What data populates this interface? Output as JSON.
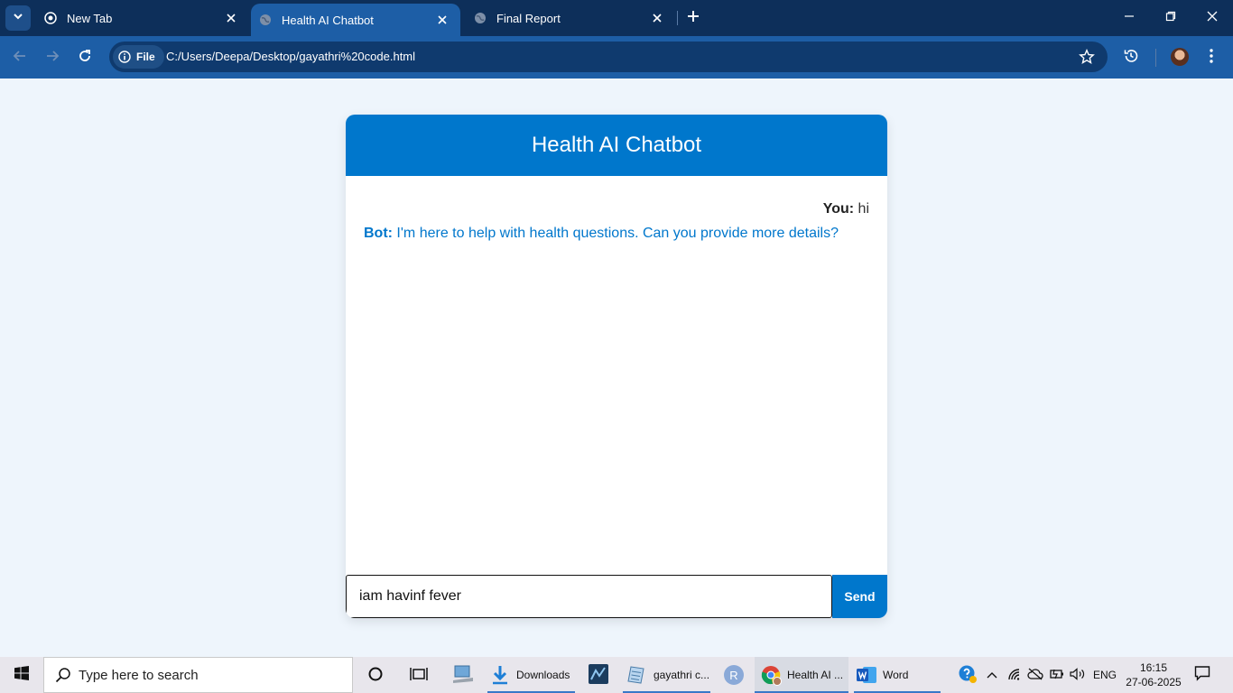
{
  "browser": {
    "tabs": [
      {
        "title": "New Tab",
        "active": false
      },
      {
        "title": "Health AI Chatbot",
        "active": true
      },
      {
        "title": "Final Report",
        "active": false
      }
    ],
    "site_chip": "File",
    "url": "C:/Users/Deepa/Desktop/gayathri%20code.html"
  },
  "page": {
    "header_title": "Health AI Chatbot",
    "messages": [
      {
        "sender": "You:",
        "text": " hi"
      },
      {
        "sender": "Bot:",
        "text": " I'm here to help with health questions. Can you provide more details?"
      }
    ],
    "input_value": "iam havinf fever",
    "send_label": "Send"
  },
  "taskbar": {
    "search_placeholder": "Type here to search",
    "apps": [
      {
        "label": "Downloads"
      },
      {
        "label": "gayathri c..."
      },
      {
        "label": "R"
      },
      {
        "label": "Health AI ..."
      },
      {
        "label": "Word"
      }
    ],
    "language": "ENG",
    "time": "16:15",
    "date": "27-06-2025"
  },
  "colors": {
    "brand_blue": "#0077cc",
    "page_bg": "#eef5fc",
    "chrome_dark": "#0d2f5a",
    "chrome_toolbar": "#1d5ea6"
  }
}
